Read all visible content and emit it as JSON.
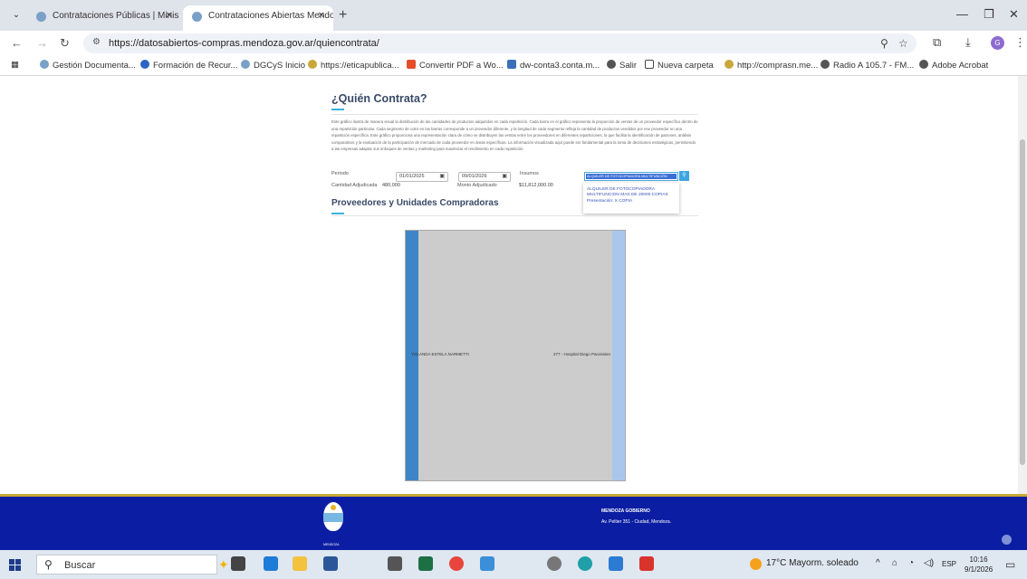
{
  "browser": {
    "tabs": [
      {
        "title": "Contrataciones Públicas | Minis",
        "active": false
      },
      {
        "title": "Contrataciones Abiertas Mendo",
        "active": true
      }
    ],
    "url": "https://datosabiertos-compras.mendoza.gov.ar/quiencontrata/",
    "bookmarks": [
      "Gestión Documenta...",
      "Formación de Recur...",
      "DGCyS Inicio",
      "https://eticapublica...",
      "Convertir PDF a Wo...",
      "dw-conta3.conta.m...",
      "Salir",
      "Nueva carpeta",
      "http://comprasn.me...",
      "Radio A 105.7 - FM...",
      "Adobe Acrobat"
    ],
    "profile_initial": "G"
  },
  "page": {
    "title": "¿Quién Contrata?",
    "description": "Este gráfico ilustra de manera visual la distribución de las cantidades de productos adquiridos en cada repartición. Cada barra en el gráfico representa la proporción de ventas de un proveedor específico dentro de una repartición particular. Cada segmento de color en las barras corresponde a un proveedor diferente, y la longitud de cada segmento refleja la cantidad de productos vendidos por ese proveedor en una repartición específica. Este gráfico proporciona una representación clara de cómo se distribuyen las ventas entre los proveedores en diferentes reparticiones, lo que facilita la identificación de patrones, análisis comparativos y la evaluación de la participación de mercado de cada proveedor en áreas específicas. La información visualizada aquí puede ser fundamental para la toma de decisiones estratégicas, permitiendo a las empresas adaptar sus enfoques de ventas y marketing para maximizar el rendimiento en cada repartición.",
    "filters": {
      "periodo_label": "Periodo",
      "date_from": "01/01/2025",
      "date_to": "09/01/2026",
      "insumo_label": "Insumos",
      "insumo_value": "ALQUILER DE FOTOCOPIADORA MULTIFUNCIÓN",
      "dropdown_option": "ALQUILER DE FOTOCOPIADORA MULTIFUNCION MAS DE 20000 COPIAS Presentación: X COPIA",
      "cantidad_label": "Cantidad Adjudicada",
      "cantidad_value": "480,000",
      "monto_label": "Monto Adjudicado",
      "monto_value": "$11,812,000.00"
    },
    "section2_title": "Proveedores y Unidades Compradoras",
    "chart": {
      "left_node": "YOLANDA ESTELA NARMETTI",
      "right_node": "277 - Hospital Diego Paroissien"
    }
  },
  "footer": {
    "emblem_text": "MENDOZA",
    "title": "MENDOZA GOBIERNO",
    "address": "Av. Peltier 351 - Ciudad, Mendoza."
  },
  "taskbar": {
    "search_placeholder": "Buscar",
    "weather": "17°C  Mayorm. soleado",
    "lang": "ESP",
    "time": "10:16",
    "date": "9/1/2026"
  }
}
